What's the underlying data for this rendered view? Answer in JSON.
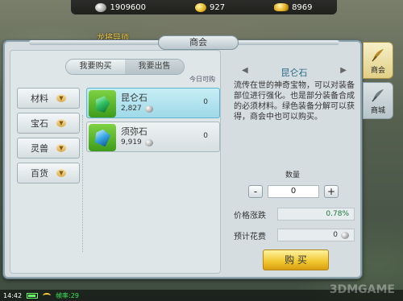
{
  "currency": {
    "silver": "1909600",
    "gold": "927",
    "ingot": "8969"
  },
  "npc_name": "龙将导师",
  "panel_title": "商会",
  "tabs": {
    "buy": "我要购买",
    "sell": "我要出售"
  },
  "today_available_label": "今日可购",
  "categories": [
    {
      "label": "材料"
    },
    {
      "label": "宝石"
    },
    {
      "label": "灵兽"
    },
    {
      "label": "百货"
    }
  ],
  "items": [
    {
      "name": "昆仑石",
      "price": "2,827",
      "available": "0",
      "selected": true
    },
    {
      "name": "须弥石",
      "price": "9,919",
      "available": "0",
      "selected": false
    }
  ],
  "detail": {
    "name": "昆仑石",
    "description": "流传在世的神奇宝物，可以对装备部位进行强化。也是部分装备合成的必须材料。绿色装备分解可以获得，商会中也可以购买。"
  },
  "quantity": {
    "label": "数量",
    "value": "0",
    "minus": "-",
    "plus": "+"
  },
  "price_change": {
    "label": "价格涨跌",
    "value": "0.78%"
  },
  "estimated_cost": {
    "label": "预计花费",
    "value": "0"
  },
  "buy_button": "购 买",
  "side_tabs": [
    {
      "label": "商会",
      "active": true
    },
    {
      "label": "商城",
      "active": false
    }
  ],
  "status": {
    "time": "14:42",
    "fps": "帧率:29"
  },
  "watermark": "3DMGAME"
}
